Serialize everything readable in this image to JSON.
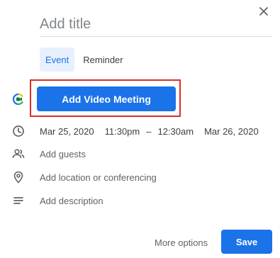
{
  "dialog": {
    "close_icon": "close-icon",
    "title": {
      "value": "",
      "placeholder": "Add title"
    },
    "tabs": [
      {
        "label": "Event",
        "active": true
      },
      {
        "label": "Reminder",
        "active": false
      }
    ],
    "video": {
      "icon": "google-meet-icon",
      "button_label": "Add Video Meeting"
    },
    "datetime": {
      "icon": "clock-icon",
      "start_date": "Mar 25, 2020",
      "start_time": "11:30pm",
      "separator": "–",
      "end_time": "12:30am",
      "end_date": "Mar 26, 2020"
    },
    "guests": {
      "icon": "people-icon",
      "placeholder": "Add guests"
    },
    "location": {
      "icon": "location-pin-icon",
      "placeholder": "Add location or conferencing"
    },
    "description": {
      "icon": "notes-icon",
      "placeholder": "Add description"
    },
    "footer": {
      "more_options_label": "More options",
      "save_label": "Save"
    }
  },
  "colors": {
    "accent": "#1a73e8",
    "highlight_border": "#d93025",
    "tab_active_bg": "#e8f0fe",
    "meet_green": "#00832d"
  }
}
